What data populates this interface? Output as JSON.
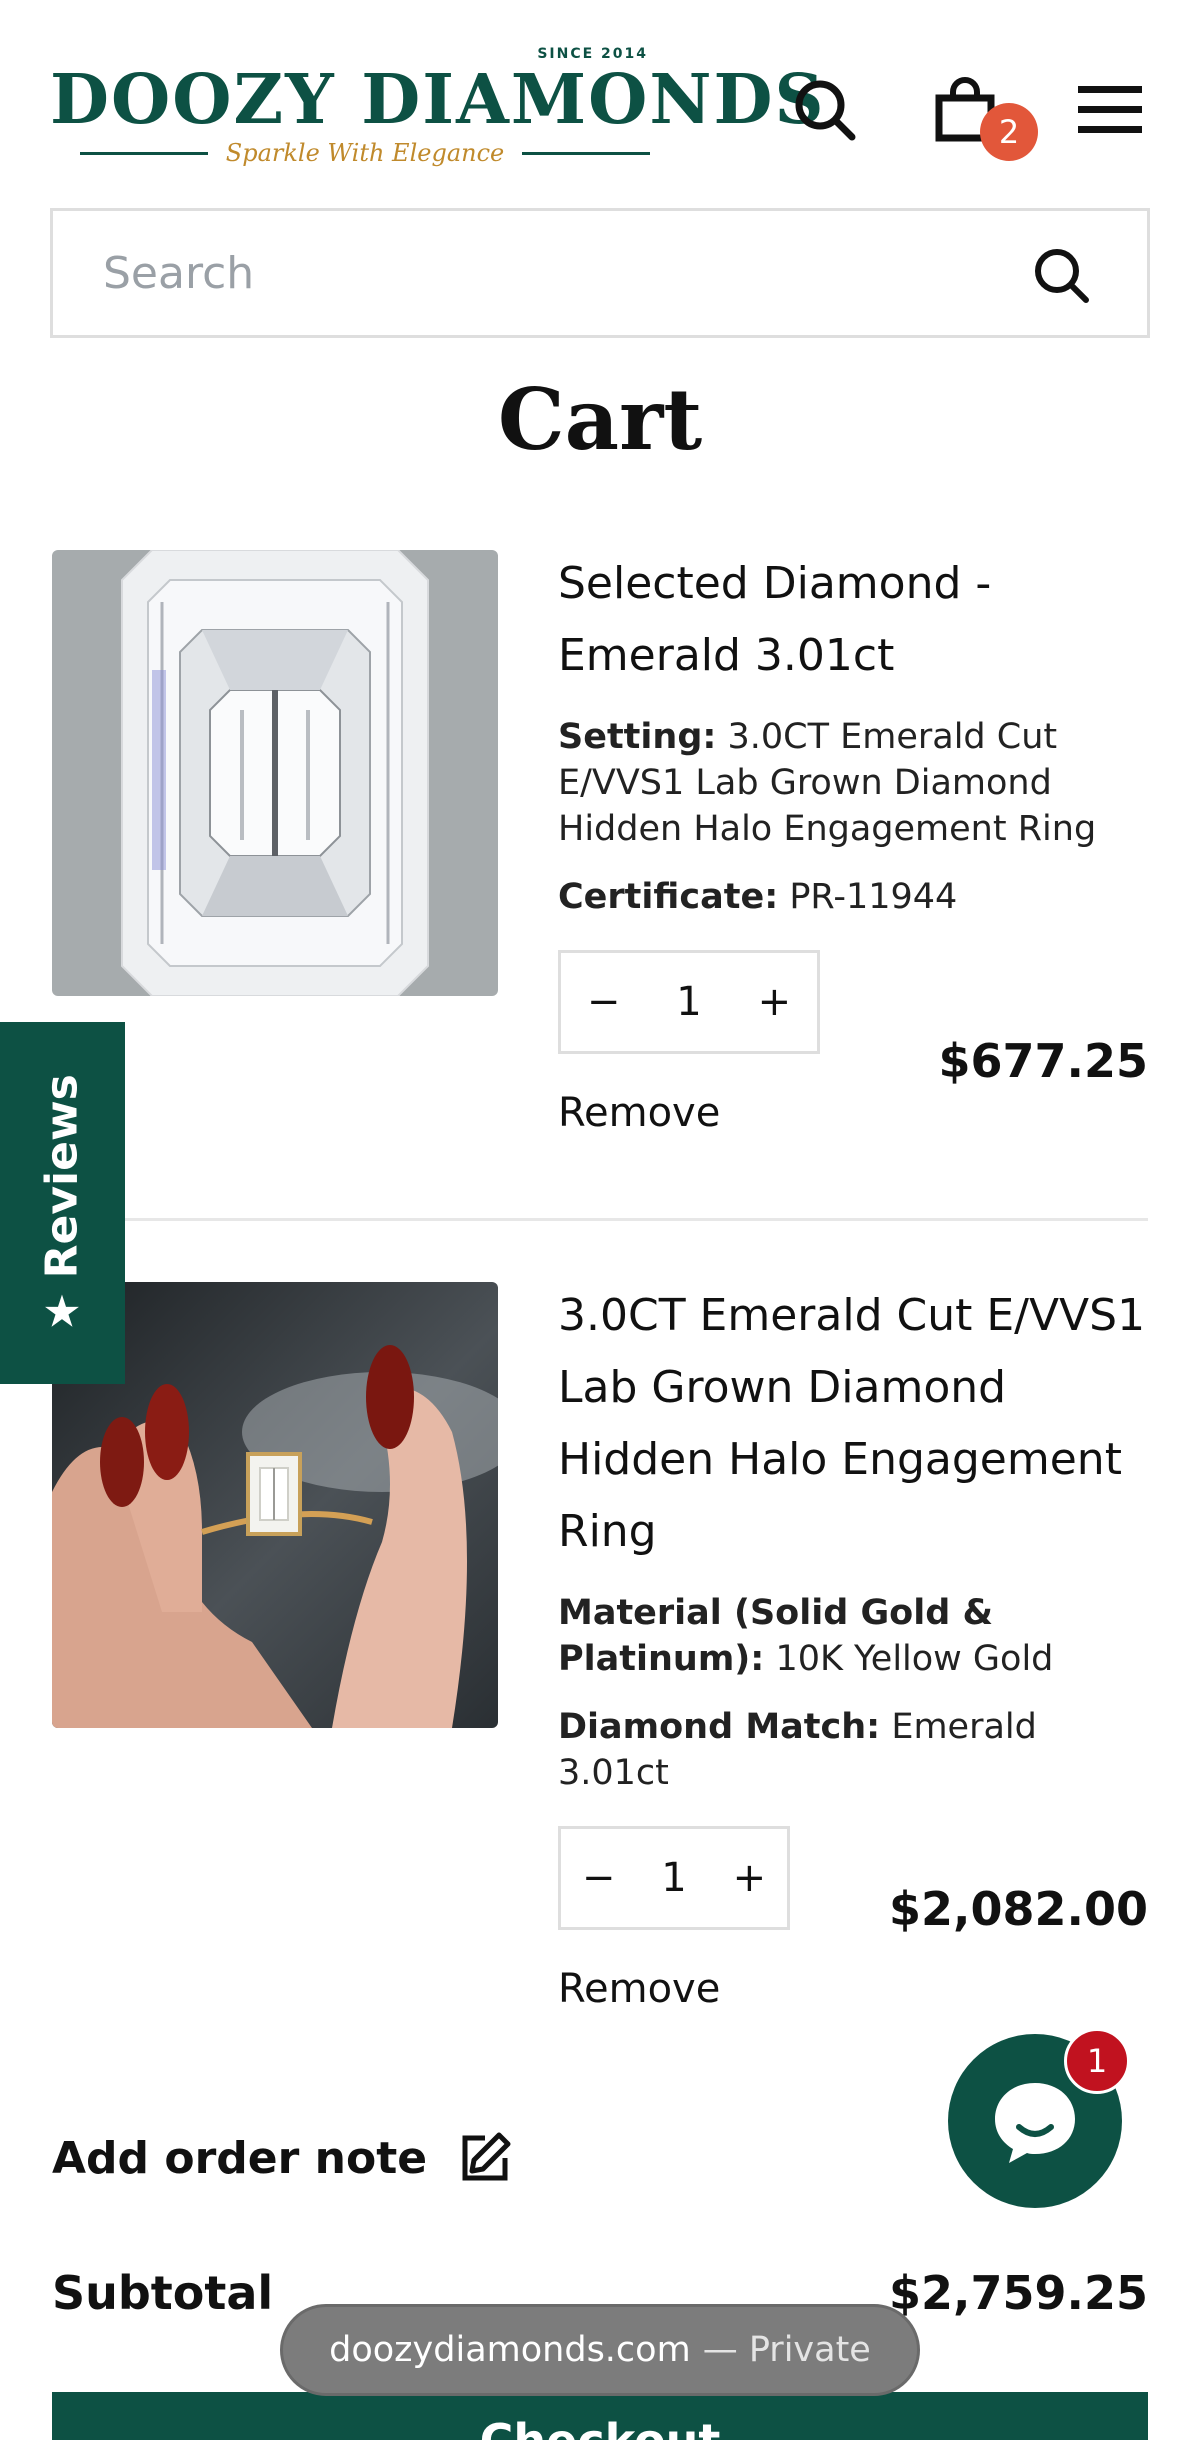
{
  "brand": {
    "since": "SINCE 2014",
    "name": "DOOZY DIAMONDS",
    "tagline": "Sparkle With Elegance",
    "primary_color": "#0d5144",
    "gold_color": "#c08a2c"
  },
  "header": {
    "icons": [
      "search-icon",
      "bag-icon",
      "menu-icon"
    ],
    "cart_count": "2"
  },
  "search": {
    "placeholder": "Search"
  },
  "page": {
    "title": "Cart"
  },
  "cart": {
    "items": [
      {
        "title": "Selected Diamond - Emerald 3.01ct",
        "props": [
          {
            "label": "Setting:",
            "value": "3.0CT Emerald Cut E/VVS1 Lab Grown Diamond Hidden Halo Engagement Ring"
          },
          {
            "label": "Certificate:",
            "value": "PR-11944"
          }
        ],
        "quantity": "1",
        "minus": "−",
        "plus": "+",
        "remove": "Remove",
        "price": "$677.25"
      },
      {
        "title": "3.0CT Emerald Cut E/VVS1 Lab Grown Diamond Hidden Halo Engagement Ring",
        "props": [
          {
            "label": "Material (Solid Gold & Platinum):",
            "value": "10K Yellow Gold"
          },
          {
            "label": "Diamond Match:",
            "value": "Emerald 3.01ct"
          }
        ],
        "quantity": "1",
        "minus": "−",
        "plus": "+",
        "remove": "Remove",
        "price": "$2,082.00"
      }
    ],
    "order_note": "Add order note",
    "subtotal_label": "Subtotal",
    "subtotal_value": "$2,759.25",
    "checkout": "Checkout"
  },
  "reviews_tab": {
    "star": "★",
    "label": "Reviews"
  },
  "chat": {
    "badge": "1"
  },
  "browser": {
    "domain": "doozydiamonds.com",
    "privacy": "— Private"
  }
}
